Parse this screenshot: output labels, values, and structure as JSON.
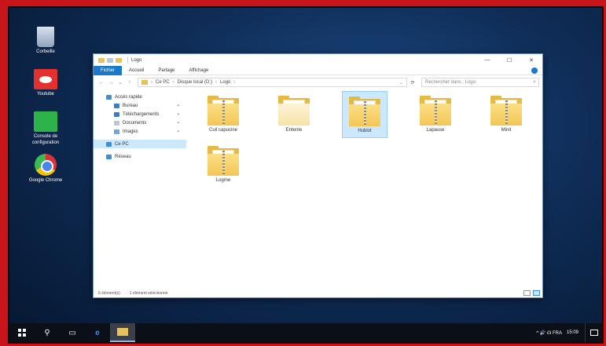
{
  "desktop": {
    "icons": [
      {
        "label": "Corbeille"
      },
      {
        "label": "Youtube"
      },
      {
        "label": "Console de configuration"
      },
      {
        "label": "Google Chrome"
      }
    ]
  },
  "window": {
    "title": "Logo",
    "controls": {
      "minimize": "—",
      "maximize": "☐",
      "close": "✕"
    },
    "ribbon_tabs": [
      "Fichier",
      "Accueil",
      "Partage",
      "Affichage"
    ],
    "address": {
      "segments": [
        "Ce PC",
        "Disque local (D:)",
        "Logo"
      ],
      "search_placeholder": "Rechercher dans : Logo"
    },
    "nav": {
      "quick_access": "Accès rapide",
      "pinned": [
        "Bureau",
        "Téléchargements",
        "Documents",
        "Images"
      ],
      "this_pc": "Ce PC",
      "network": "Réseau"
    },
    "folders": [
      "Cuil capucine",
      "Entente",
      "Hublot",
      "Lapasse",
      "Minit",
      "Logme"
    ],
    "status": {
      "count": "6 élément(s)",
      "selection": "1 élément sélectionné"
    }
  },
  "taskbar": {
    "time": "15:09",
    "tray": "^ 🔊 ☊ FRA"
  }
}
